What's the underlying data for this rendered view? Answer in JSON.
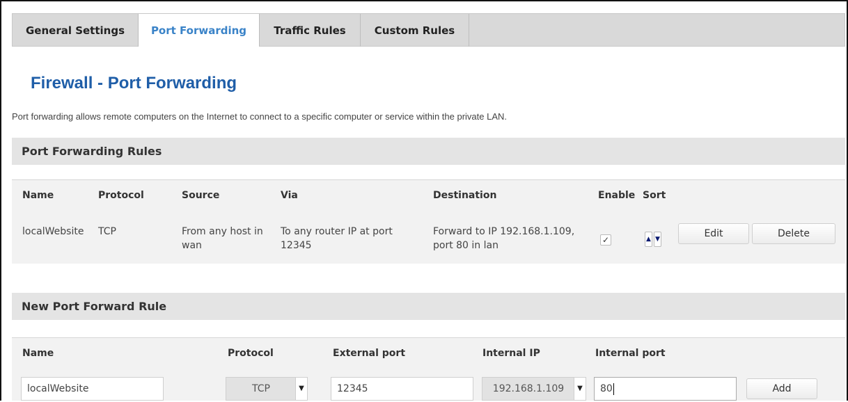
{
  "tabs": [
    {
      "label": "General Settings",
      "active": false
    },
    {
      "label": "Port Forwarding",
      "active": true
    },
    {
      "label": "Traffic Rules",
      "active": false
    },
    {
      "label": "Custom Rules",
      "active": false
    }
  ],
  "page_title": "Firewall - Port Forwarding",
  "description": "Port forwarding allows remote computers on the Internet to connect to a specific computer or service within the private LAN.",
  "rules_section": {
    "title": "Port Forwarding Rules",
    "columns": [
      "Name",
      "Protocol",
      "Source",
      "Via",
      "Destination",
      "Enable",
      "Sort"
    ],
    "rows": [
      {
        "name": "localWebsite",
        "protocol": "TCP",
        "source": "From any host in wan",
        "via": "To any router IP at port 12345",
        "destination": "Forward to IP 192.168.1.109, port 80 in lan",
        "enabled": true,
        "enable_mark": "✓",
        "sort_up": "▲",
        "sort_down": "▼",
        "edit_label": "Edit",
        "delete_label": "Delete"
      }
    ]
  },
  "new_rule_section": {
    "title": "New Port Forward Rule",
    "columns": [
      "Name",
      "Protocol",
      "External port",
      "Internal IP",
      "Internal port"
    ],
    "name_value": "localWebsite",
    "protocol_value": "TCP",
    "external_port_value": "12345",
    "internal_ip_value": "192.168.1.109",
    "internal_port_value": "80",
    "caret": "▼",
    "add_label": "Add"
  }
}
